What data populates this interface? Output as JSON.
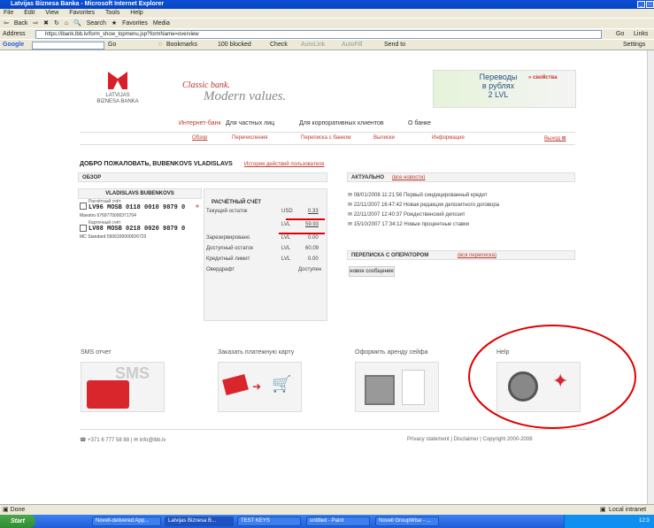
{
  "window": {
    "title": "Latvijas Biznesa Banka - Microsoft Internet Explorer"
  },
  "menu": [
    "File",
    "Edit",
    "View",
    "Favorites",
    "Tools",
    "Help"
  ],
  "toolbar": {
    "back": "Back",
    "search": "Search",
    "favorites": "Favorites",
    "media": "Media"
  },
  "address": {
    "label": "Address",
    "url": "https://ibank.lbb.lv/form_show_topmenu.jsp?formName=overview",
    "go": "Go",
    "links": "Links"
  },
  "google": {
    "label": "Google",
    "go": "Go",
    "bookmarks": "Bookmarks",
    "blocked": "100 blocked",
    "check": "Check",
    "autolink": "AutoLink",
    "autofill": "AutoFill",
    "sendto": "Send to",
    "settings": "Settings"
  },
  "site": {
    "logo_text_1": "LATVIJAS",
    "logo_text_2": "BIZNESA BANKA",
    "slogan_1": "Classic bank.",
    "slogan_2": "Modern values.",
    "banner_text_1": "Переводы",
    "banner_text_2": "в рублях",
    "banner_text_3": "2 LVL",
    "banner_link": "» свойства",
    "nav1": [
      "Интернет-банк",
      "Для частных лиц",
      "Для корпоративных клиентов",
      "О банке"
    ],
    "nav2": [
      "Обзор",
      "Перечисления",
      "Переписка с банком",
      "Выписки",
      "Информация",
      "Выход"
    ],
    "welcome": "ДОБРО ПОЖАЛОВАТЬ, BUBENKOVS VLADISLAVS",
    "history_link": "История действий пользователя",
    "overview_title": "ОБЗОР",
    "client_name": "VLADISLAVS BUBENKOVS",
    "acc1_type": "Расчётный счёт",
    "acc1_no": "LV96 MOSB 0118 0010 9879 0",
    "acc1_card": "Maestro 6769770000371704",
    "acc2_type": "Карточный счёт",
    "acc2_no": "LV08 MOSB 0218 0020 9879 0",
    "acc2_card": "MC Standard 5506330000026723",
    "detail_title": "РАСЧЁТНЫЙ СЧЁТ",
    "detail_rows": [
      {
        "label": "Текущий остаток",
        "cur": "USD",
        "val": "0.33"
      },
      {
        "label": "",
        "cur": "LVL",
        "val": "59.93"
      },
      {
        "label": "Зарезервировано",
        "cur": "LVL",
        "val": "0.00"
      },
      {
        "label": "Доступный остаток",
        "cur": "LVL",
        "val": "60.09"
      },
      {
        "label": "Кредитный лимит",
        "cur": "LVL",
        "val": "0.00"
      },
      {
        "label": "Овердрафт",
        "cur": "",
        "val": "Доступен"
      }
    ],
    "news_title": "АКТУАЛЬНО",
    "news_link": "(все новости)",
    "news": [
      "08/01/2008 11:21:56 Первый синдицированный кредит",
      "22/11/2007 16:47:42 Новая редакция депозитного договора",
      "22/11/2007 12:40:37 Рождественский депозит",
      "15/10/2007 17:34:12 Новые процентные ставки"
    ],
    "corr_title": "ПЕРЕПИСКА С ОПЕРАТОРОМ",
    "corr_link": "(вся переписка)",
    "new_message": "новое сообщение",
    "services": [
      "SMS отчет",
      "Заказать платежную карту",
      "Оформить аренду сейфа",
      "Help"
    ],
    "sms_img_text": "SMS",
    "phone": "+371 6 777 58 88",
    "email": "info@lbb.lv",
    "footer_links": [
      "Privacy statement",
      "Disclaimer",
      "Copyright 2000-2008"
    ]
  },
  "status": {
    "done": "Done",
    "zone": "Local intranet"
  },
  "taskbar": {
    "start": "Start",
    "tasks": [
      "Novell-delivered App...",
      "Latvijas Biznesa B...",
      "TEST KEYS",
      "untitled - Paint",
      "Novell GroupWise - ..."
    ],
    "clock": "12:3"
  },
  "colors": {
    "accent_red": "#c0392b",
    "annotation_red": "#e00000",
    "xp_blue": "#0a4fd4"
  }
}
